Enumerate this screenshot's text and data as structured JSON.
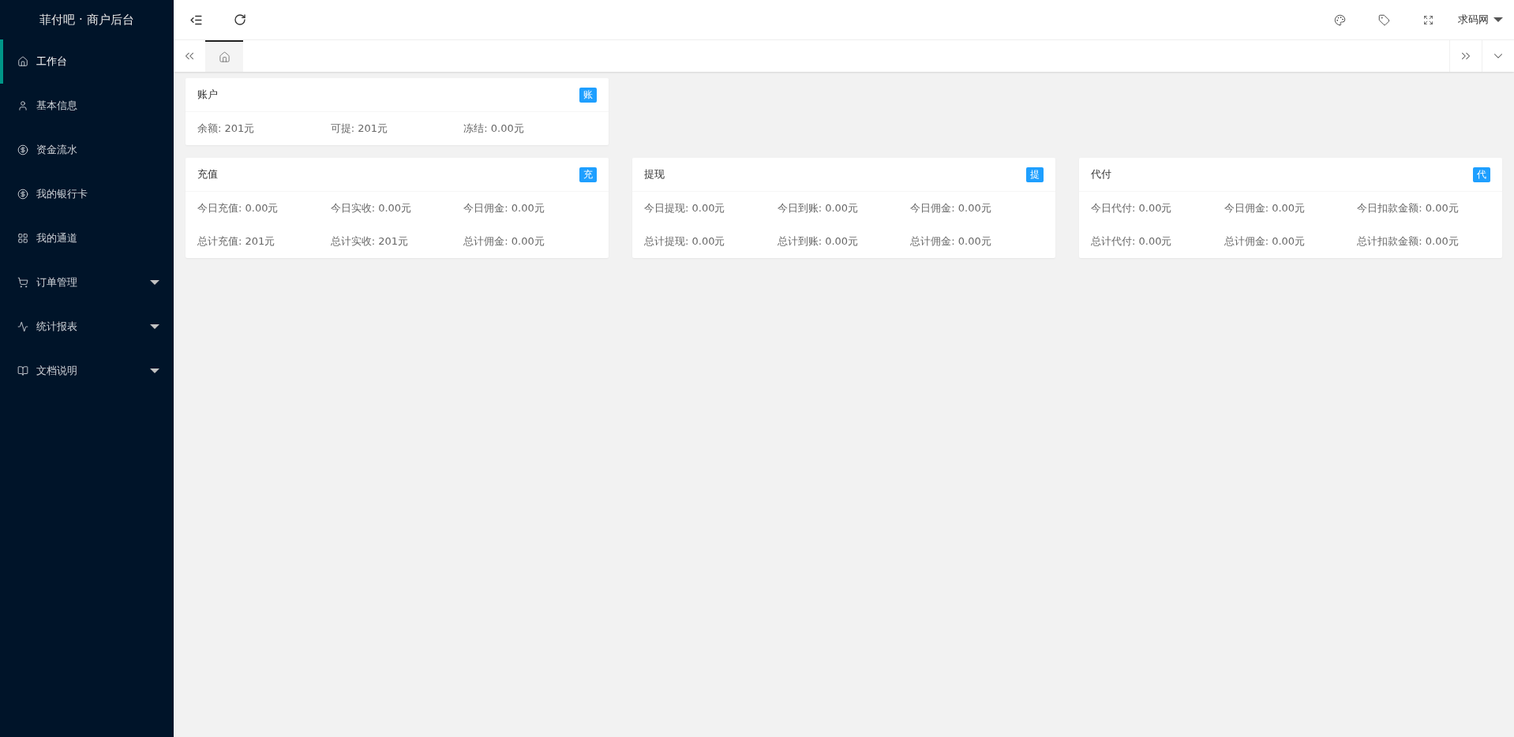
{
  "sidebar": {
    "title": "菲付吧 · 商户后台",
    "items": [
      {
        "label": "工作台",
        "selected": true,
        "expandable": false
      },
      {
        "label": "基本信息",
        "selected": false,
        "expandable": false
      },
      {
        "label": "资金流水",
        "selected": false,
        "expandable": false
      },
      {
        "label": "我的银行卡",
        "selected": false,
        "expandable": false
      },
      {
        "label": "我的通道",
        "selected": false,
        "expandable": false
      },
      {
        "label": "订单管理",
        "selected": false,
        "expandable": true
      },
      {
        "label": "统计报表",
        "selected": false,
        "expandable": true
      },
      {
        "label": "文档说明",
        "selected": false,
        "expandable": true
      }
    ]
  },
  "header": {
    "user": "求码网"
  },
  "tabs": [
    {
      "selected": true
    }
  ],
  "cards": [
    {
      "title": "账户",
      "badge": "账",
      "rows": [
        [
          "余额: 201元",
          "可提: 201元",
          "冻结: 0.00元"
        ]
      ]
    },
    {
      "title": "充值",
      "badge": "充",
      "rows": [
        [
          "今日充值: 0.00元",
          "今日实收: 0.00元",
          "今日佣金: 0.00元"
        ],
        [
          "总计充值: 201元",
          "总计实收: 201元",
          "总计佣金: 0.00元"
        ]
      ]
    },
    {
      "title": "提现",
      "badge": "提",
      "rows": [
        [
          "今日提现: 0.00元",
          "今日到账: 0.00元",
          "今日佣金: 0.00元"
        ],
        [
          "总计提现: 0.00元",
          "总计到账: 0.00元",
          "总计佣金: 0.00元"
        ]
      ]
    },
    {
      "title": "代付",
      "badge": "代",
      "rows": [
        [
          "今日代付: 0.00元",
          "今日佣金: 0.00元",
          "今日扣款金额: 0.00元"
        ],
        [
          "总计代付: 0.00元",
          "总计佣金: 0.00元",
          "总计扣款金额: 0.00元"
        ]
      ]
    }
  ]
}
